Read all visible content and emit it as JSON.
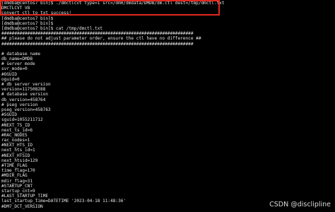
{
  "terminal": {
    "lines": [
      "[dmdba@centos7 bin]$ ./dmctlcvt type=1 src=/dm0/dmdata/DMDB/dm.ctl dest=/tmp/dmctl.txt",
      "DMCTLCVT V8",
      "convert ctl to txt success!",
      "[dmdba@centos7 bin]$",
      "[dmdba@centos7 bin]$",
      "[dmdba@centos7 bin]$ cat /tmp/dmctl.txt",
      "##########################################################################",
      "## please do not adjust parameter order, ensure the ctl have no difference ##",
      "##########################################################################",
      "",
      "# database name",
      "db_name=DMDB",
      "# server mode",
      "svr_mode=0",
      "#OGUID",
      "oguid=0",
      "# db server version",
      "version=117508288",
      "# database version",
      "db_version=458764",
      "# pseg version",
      "pseg_version=458763",
      "#SGUID",
      "sguid=1055211712",
      "#NEXT_TS_ID",
      "next_ts_id=6",
      "#RAC_NODES",
      "rac_nodes=1",
      "#NEXT_HTS_ID",
      "next_hts_id=1",
      "#NEXT_HTSID",
      "next_htsid=129",
      "#TIME_FLAG",
      "time_flag=170",
      "#MDIR_FLAG",
      "mdir_flag=31",
      "#STARTUP_CNT",
      "startup_cnt=9",
      "#LAST_STARTUP_TIME",
      "last_startup_time=DATETIME '2023-04-18 11:48:36'",
      "#DM7_DCT_VERSION"
    ]
  },
  "watermark": {
    "text": "CSDN @disclipline"
  },
  "colors": {
    "background": "#000000",
    "text": "#e6e6e6",
    "highlight_border": "#e0281e",
    "watermark": "#d8d8d8"
  }
}
